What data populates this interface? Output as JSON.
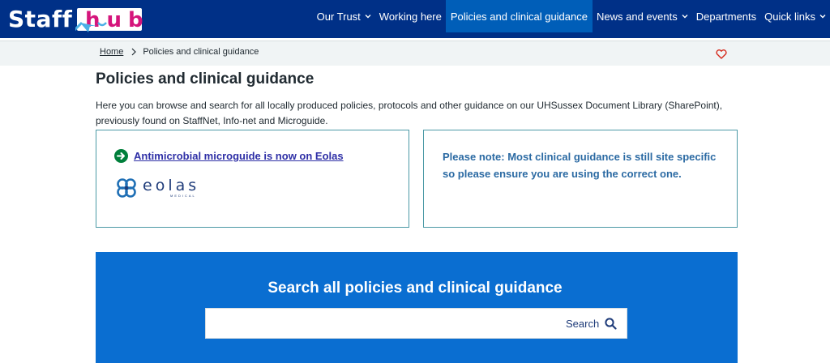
{
  "header": {
    "logo_left": "Staff",
    "logo_right": "hub",
    "nav": [
      {
        "label": "Our Trust",
        "dropdown": true
      },
      {
        "label": "Working here",
        "dropdown": false
      },
      {
        "label": "Policies and clinical guidance",
        "dropdown": false,
        "active": true
      },
      {
        "label": "News and events",
        "dropdown": true
      },
      {
        "label": "Departments",
        "dropdown": false
      },
      {
        "label": "Quick links",
        "dropdown": true
      }
    ]
  },
  "breadcrumb": {
    "home": "Home",
    "current": "Policies and clinical guidance"
  },
  "page": {
    "title": "Policies and clinical guidance",
    "intro": "Here you can browse and search for all locally produced policies, protocols and other guidance on our UHSussex Document Library (SharePoint), previously found on StaffNet, Info-net and Microguide."
  },
  "cards": {
    "left": {
      "link": "Antimicrobial microguide is now on Eolas",
      "logo_text": "eolas",
      "logo_sub": "MEDICAL"
    },
    "right": {
      "note": "Please note: Most clinical guidance is still site specific so please ensure you are using the correct one."
    }
  },
  "search": {
    "title": "Search all policies and clinical guidance",
    "button_label": "Search",
    "placeholder": ""
  },
  "colors": {
    "header_bg": "#003087",
    "nav_active_bg": "#005eb8",
    "search_panel_bg": "#0a6ed1",
    "card_border": "#4c9aa6",
    "link": "#2e2fa6",
    "note_text": "#2b6aa3",
    "hub_pink": "#d5157c"
  },
  "icons": [
    "chevron-down-icon",
    "chevron-right-icon",
    "heart-icon",
    "arrow-right-circle-icon",
    "eolas-logo-icon",
    "search-icon"
  ]
}
